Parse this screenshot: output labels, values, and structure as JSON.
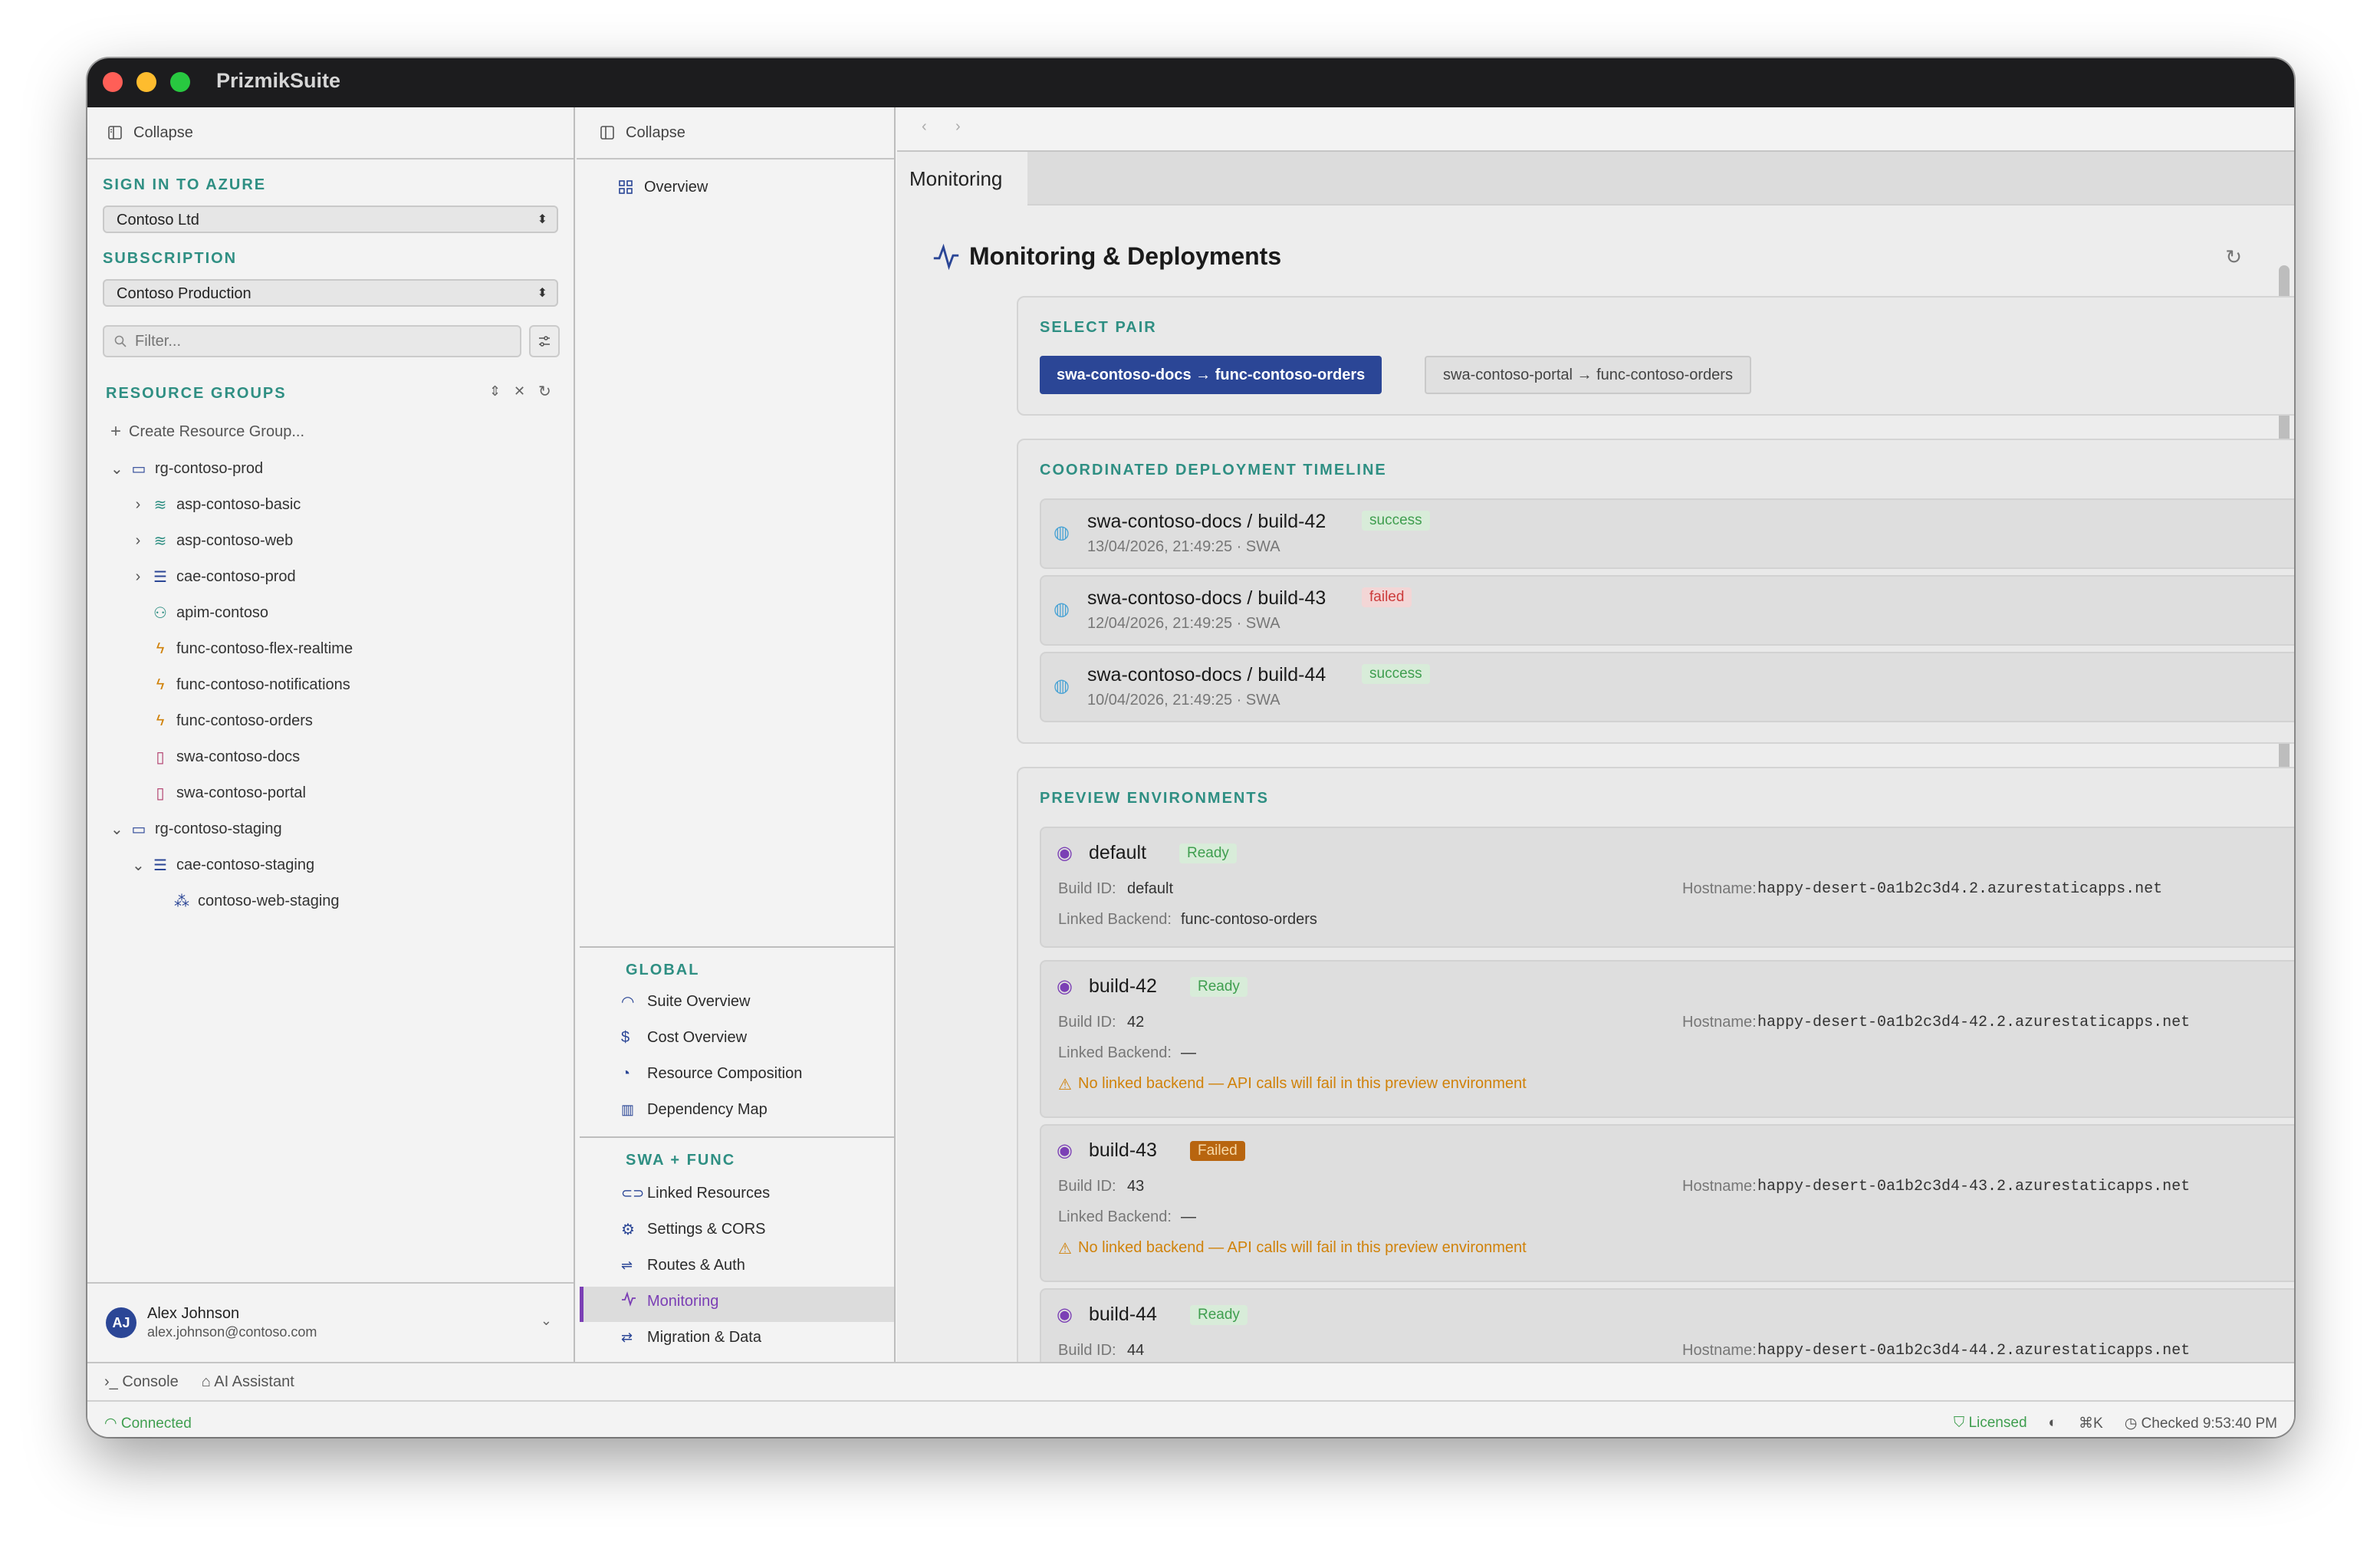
{
  "app": {
    "title": "PrizmikSuite"
  },
  "left": {
    "collapse_label": "Collapse",
    "sign_in_label": "SIGN IN TO AZURE",
    "tenant": "Contoso Ltd",
    "subscription_label": "SUBSCRIPTION",
    "subscription": "Contoso Production",
    "filter_placeholder": "Filter...",
    "resource_groups_label": "RESOURCE GROUPS",
    "create_label": "Create Resource Group...",
    "tree": [
      {
        "label": "rg-contoso-prod",
        "icon": "folder-icon"
      },
      {
        "label": "asp-contoso-basic",
        "icon": "layers-icon"
      },
      {
        "label": "asp-contoso-web",
        "icon": "layers-icon"
      },
      {
        "label": "cae-contoso-prod",
        "icon": "server-icon"
      },
      {
        "label": "apim-contoso",
        "icon": "network-icon"
      },
      {
        "label": "func-contoso-flex-realtime",
        "icon": "bolt-icon"
      },
      {
        "label": "func-contoso-notifications",
        "icon": "bolt-icon"
      },
      {
        "label": "func-contoso-orders",
        "icon": "bolt-icon"
      },
      {
        "label": "swa-contoso-docs",
        "icon": "file-icon"
      },
      {
        "label": "swa-contoso-portal",
        "icon": "file-icon"
      },
      {
        "label": "rg-contoso-staging",
        "icon": "folder-icon"
      },
      {
        "label": "cae-contoso-staging",
        "icon": "server-icon"
      },
      {
        "label": "contoso-web-staging",
        "icon": "cluster-icon"
      }
    ],
    "user": {
      "initials": "AJ",
      "name": "Alex Johnson",
      "email": "alex.johnson@contoso.com"
    }
  },
  "mid": {
    "collapse_label": "Collapse",
    "overview_label": "Overview",
    "global_label": "GLOBAL",
    "global_items": [
      "Suite Overview",
      "Cost Overview",
      "Resource Composition",
      "Dependency Map"
    ],
    "swa_label": "SWA + FUNC",
    "swa_items": [
      "Linked Resources",
      "Settings & CORS",
      "Routes & Auth",
      "Monitoring",
      "Migration & Data"
    ]
  },
  "main": {
    "tab_label": "Monitoring",
    "page_title": "Monitoring & Deployments",
    "select_pair_label": "SELECT PAIR",
    "pairs": [
      "swa-contoso-docs → func-contoso-orders",
      "swa-contoso-portal → func-contoso-orders"
    ],
    "timeline_label": "COORDINATED DEPLOYMENT TIMELINE",
    "timeline": [
      {
        "title": "swa-contoso-docs / build-42",
        "status": "success",
        "meta": "13/04/2026, 21:49:25 · SWA"
      },
      {
        "title": "swa-contoso-docs / build-43",
        "status": "failed",
        "meta": "12/04/2026, 21:49:25 · SWA"
      },
      {
        "title": "swa-contoso-docs / build-44",
        "status": "success",
        "meta": "10/04/2026, 21:49:25 · SWA"
      }
    ],
    "preview_label": "PREVIEW ENVIRONMENTS",
    "labels": {
      "build_id": "Build ID:",
      "hostname": "Hostname:",
      "linked": "Linked Backend:"
    },
    "envs": [
      {
        "name": "default",
        "status": "Ready",
        "build_id": "default",
        "hostname": "happy-desert-0a1b2c3d4.2.azurestaticapps.net",
        "linked": "func-contoso-orders",
        "warning": ""
      },
      {
        "name": "build-42",
        "status": "Ready",
        "build_id": "42",
        "hostname": "happy-desert-0a1b2c3d4-42.2.azurestaticapps.net",
        "linked": "—",
        "warning": "No linked backend — API calls will fail in this preview environment"
      },
      {
        "name": "build-43",
        "status": "Failed",
        "build_id": "43",
        "hostname": "happy-desert-0a1b2c3d4-43.2.azurestaticapps.net",
        "linked": "—",
        "warning": "No linked backend — API calls will fail in this preview environment"
      },
      {
        "name": "build-44",
        "status": "Ready",
        "build_id": "44",
        "hostname": "happy-desert-0a1b2c3d4-44.2.azurestaticapps.net",
        "linked": "",
        "warning": ""
      }
    ]
  },
  "bottom": {
    "console_label": "Console",
    "ai_label": "AI Assistant",
    "connected_label": "Connected",
    "licensed_label": "Licensed",
    "shortcut": "⌘K",
    "checked": "Checked 9:53:40 PM"
  },
  "colors": {
    "accent": "#2f8f83",
    "primary": "#2b4696",
    "success": "#3f9e4f",
    "danger": "#cc3b3b",
    "warning": "#d0820a",
    "purple": "#7b3fb5"
  }
}
